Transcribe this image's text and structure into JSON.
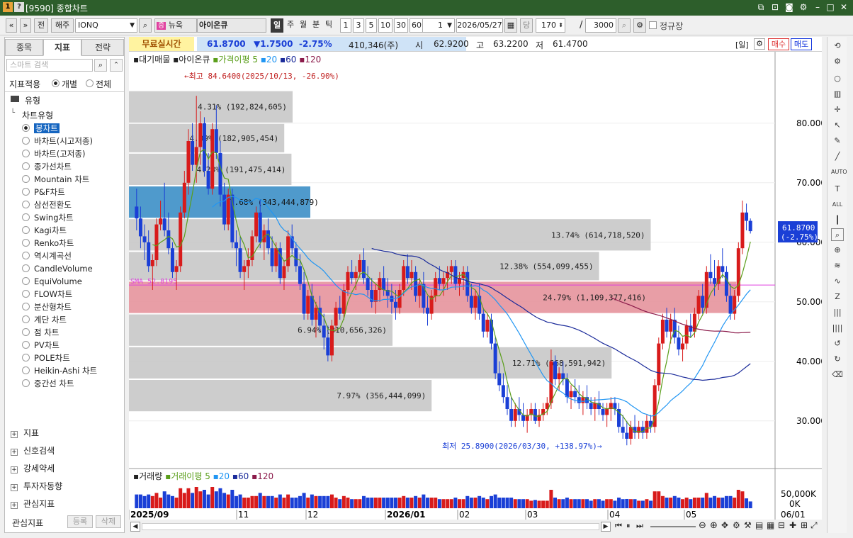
{
  "window": {
    "title": "[9590] 종합차트"
  },
  "toolbar": {
    "nav_prev": "«",
    "nav_next": "»",
    "btn_jeon": "전",
    "market": "해주",
    "symbol": "IONQ",
    "news_label": "뉴옥",
    "stock_name": "아이온큐",
    "periods": [
      "일",
      "주",
      "월",
      "분",
      "틱"
    ],
    "intervals": [
      "1",
      "3",
      "5",
      "10",
      "30",
      "60"
    ],
    "interval_value": "1",
    "date": "2026/05/27",
    "dang": "당",
    "count": "170",
    "total": "3000",
    "regular_session_label": "정규장"
  },
  "left": {
    "tabs": [
      "종목",
      "지표",
      "전략"
    ],
    "search_placeholder": "스마트 검색",
    "apply_label": "지표적용",
    "apply_options": [
      "개별",
      "전체"
    ],
    "section_type": "유형",
    "chart_type_title": "차트유형",
    "chart_types": [
      "봉차트",
      "바차트(시고저종)",
      "바차트(고저종)",
      "종가선차트",
      "Mountain 차트",
      "P&F차트",
      "삼선전환도",
      "Swing차트",
      "Kagi차트",
      "Renko차트",
      "역시계곡선",
      "CandleVolume",
      "EquiVolume",
      "FLOW차트",
      "분산형차트",
      "계단 차트",
      "점 차트",
      "PV차트",
      "POLE차트",
      "Heikin-Ashi 차트",
      "중간선 차트"
    ],
    "groups": [
      "지표",
      "신호검색",
      "강세약세",
      "투자자동향",
      "관심지표"
    ],
    "fav_label": "관심지표",
    "btn_register": "등록",
    "btn_delete": "삭제"
  },
  "info": {
    "realtime": "무료실시간",
    "price": "61.8700",
    "change": "▼1.7500",
    "change_pct": "-2.75%",
    "volume": "410,346(주)",
    "open_label": "시",
    "open": "62.9200",
    "high_label": "고",
    "high": "63.2200",
    "low_label": "저",
    "low": "61.4700",
    "period_label": "[일]",
    "buy": "매수",
    "sell": "매도"
  },
  "legend": {
    "vp": "대기매물",
    "name": "아이온큐",
    "ma_label": "가격이평",
    "ma": [
      "5",
      "20",
      "60",
      "120"
    ]
  },
  "annotations": {
    "high": "←최고 84.6400(2025/10/13, -26.90%)",
    "low": "최저 25.8900(2026/03/30, +138.97%)→",
    "sma": "SMA 52.8195"
  },
  "volume_legend": {
    "label": "거래량",
    "ma_label": "거래이평",
    "ma": [
      "5",
      "20",
      "60",
      "120"
    ]
  },
  "price_scale": [
    "80.0000",
    "70.0000",
    "60.0000",
    "50.0000",
    "40.0000",
    "30.0000"
  ],
  "volume_scale": [
    "50,000K",
    "0K"
  ],
  "current_tag": {
    "price": "61.8700",
    "pct": "(-2.75%)"
  },
  "x_labels": [
    "2025/09",
    "11",
    "12",
    "2026/01",
    "02",
    "03",
    "04",
    "05",
    "06/01"
  ],
  "colors": {
    "up": "#d81b1b",
    "down": "#1a3fd6",
    "ma5": "#5a9e1a",
    "ma20": "#2196f3",
    "ma60": "#1a2a9a",
    "ma120": "#8b1a4a"
  },
  "chart_data": {
    "type": "candlestick",
    "x_start": "2025/09",
    "x_end": "2026/05/27",
    "ylim": [
      22.0,
      92.0
    ],
    "volume_profile": [
      {
        "low": 80.0,
        "high": 85.5,
        "pct": "4.31%",
        "volume": "192,824,605",
        "label": "4.31% (192,824,605)"
      },
      {
        "low": 75.0,
        "high": 80.0,
        "pct": "4.09%",
        "volume": "182,905,454",
        "label": "4.09% (182,905,454)"
      },
      {
        "low": 69.5,
        "high": 75.0,
        "pct": "4.28%",
        "volume": "191,475,414",
        "label": "4.28% (191,475,414)"
      },
      {
        "low": 64.0,
        "high": 69.5,
        "pct": "7.68%",
        "volume": "343,444,879",
        "label": "7.68% (343,444,879)",
        "highlight": "blue"
      },
      {
        "low": 58.5,
        "high": 64.0,
        "pct": "13.74%",
        "volume": "614,718,520",
        "label": "13.74% (614,718,520)"
      },
      {
        "low": 53.5,
        "high": 58.5,
        "pct": "12.38%",
        "volume": "554,099,455",
        "label": "12.38% (554,099,455)"
      },
      {
        "low": 48.0,
        "high": 53.5,
        "pct": "24.79%",
        "volume": "1,109,377,416",
        "label": "24.79% (1,109,377,416)",
        "highlight": "red"
      },
      {
        "low": 42.5,
        "high": 48.0,
        "pct": "6.94%",
        "volume": "310,656,326",
        "label": "6.94% (310,656,326)"
      },
      {
        "low": 37.0,
        "high": 42.5,
        "pct": "12.71%",
        "volume": "568,591,942",
        "label": "12.71% (568,591,942)"
      },
      {
        "low": 31.5,
        "high": 37.0,
        "pct": "7.97%",
        "volume": "356,444,099",
        "label": "7.97% (356,444,099)"
      }
    ],
    "candles": [
      [
        66,
        69,
        62,
        64
      ],
      [
        64,
        66,
        59,
        61
      ],
      [
        61,
        63,
        57,
        60
      ],
      [
        60,
        62,
        55,
        56
      ],
      [
        56,
        58,
        52,
        57
      ],
      [
        57,
        64,
        56,
        63
      ],
      [
        63,
        67,
        62,
        64
      ],
      [
        64,
        70,
        61,
        62
      ],
      [
        62,
        65,
        58,
        59
      ],
      [
        59,
        60,
        54,
        55
      ],
      [
        55,
        57,
        52,
        56
      ],
      [
        56,
        66,
        55,
        65
      ],
      [
        65,
        72,
        64,
        70
      ],
      [
        70,
        79,
        68,
        77
      ],
      [
        77,
        80,
        72,
        73
      ],
      [
        73,
        84.6,
        70,
        76
      ],
      [
        76,
        82,
        73,
        80
      ],
      [
        80,
        81,
        71,
        72
      ],
      [
        72,
        75,
        68,
        69
      ],
      [
        69,
        80,
        68,
        79
      ],
      [
        79,
        83,
        74,
        75
      ],
      [
        75,
        77,
        66,
        68
      ],
      [
        68,
        70,
        62,
        63
      ],
      [
        63,
        69,
        62,
        68
      ],
      [
        68,
        69,
        59,
        60
      ],
      [
        60,
        62,
        56,
        59
      ],
      [
        59,
        61,
        54,
        55
      ],
      [
        55,
        57,
        52,
        56
      ],
      [
        56,
        59,
        54,
        57
      ],
      [
        57,
        62,
        56,
        61
      ],
      [
        61,
        66,
        60,
        65
      ],
      [
        65,
        67,
        59,
        60
      ],
      [
        60,
        63,
        57,
        62
      ],
      [
        62,
        64,
        58,
        59
      ],
      [
        59,
        61,
        55,
        56
      ],
      [
        56,
        60,
        55,
        59
      ],
      [
        59,
        60,
        53,
        54
      ],
      [
        54,
        57,
        52,
        56
      ],
      [
        56,
        62,
        55,
        61
      ],
      [
        61,
        63,
        58,
        59
      ],
      [
        59,
        60,
        55,
        56
      ],
      [
        56,
        58,
        52,
        53
      ],
      [
        53,
        55,
        47,
        48
      ],
      [
        48,
        52,
        47,
        51
      ],
      [
        51,
        53,
        46,
        47
      ],
      [
        47,
        50,
        44,
        49
      ],
      [
        49,
        51,
        45,
        46
      ],
      [
        46,
        48,
        42,
        44
      ],
      [
        44,
        46,
        40,
        41
      ],
      [
        41,
        47,
        40,
        46
      ],
      [
        46,
        50,
        45,
        49
      ],
      [
        49,
        51,
        47,
        48
      ],
      [
        48,
        53,
        47,
        52
      ],
      [
        52,
        56,
        51,
        55
      ],
      [
        55,
        57,
        53,
        54
      ],
      [
        54,
        56,
        52,
        55
      ],
      [
        55,
        58,
        54,
        57
      ],
      [
        57,
        59,
        53,
        54
      ],
      [
        54,
        56,
        51,
        52
      ],
      [
        52,
        54,
        49,
        50
      ],
      [
        50,
        53,
        48,
        52
      ],
      [
        52,
        55,
        50,
        54
      ],
      [
        54,
        56,
        51,
        52
      ],
      [
        52,
        54,
        49,
        51
      ],
      [
        51,
        53,
        48,
        50
      ],
      [
        50,
        52,
        47,
        49
      ],
      [
        49,
        53,
        48,
        52
      ],
      [
        52,
        57,
        51,
        56
      ],
      [
        56,
        58,
        53,
        54
      ],
      [
        54,
        57,
        52,
        55
      ],
      [
        55,
        56,
        50,
        51
      ],
      [
        51,
        54,
        49,
        53
      ],
      [
        53,
        55,
        48,
        49
      ],
      [
        49,
        51,
        46,
        48
      ],
      [
        48,
        52,
        47,
        51
      ],
      [
        51,
        55,
        50,
        54
      ],
      [
        54,
        56,
        52,
        53
      ],
      [
        53,
        55,
        51,
        54
      ],
      [
        54,
        56,
        52,
        55
      ],
      [
        55,
        57,
        53,
        56
      ],
      [
        56,
        57,
        52,
        53
      ],
      [
        53,
        55,
        51,
        54
      ],
      [
        54,
        56,
        52,
        55
      ],
      [
        55,
        56,
        50,
        51
      ],
      [
        51,
        53,
        48,
        49
      ],
      [
        49,
        52,
        47,
        51
      ],
      [
        51,
        53,
        47,
        48
      ],
      [
        48,
        49,
        44,
        45
      ],
      [
        45,
        48,
        44,
        47
      ],
      [
        47,
        48,
        42,
        43
      ],
      [
        43,
        44,
        37,
        38
      ],
      [
        38,
        40,
        35,
        36
      ],
      [
        36,
        38,
        33,
        34
      ],
      [
        34,
        36,
        31,
        32
      ],
      [
        32,
        34,
        29,
        30
      ],
      [
        30,
        33,
        29,
        32
      ],
      [
        32,
        34,
        30,
        31
      ],
      [
        31,
        33,
        29,
        30
      ],
      [
        30,
        32,
        28,
        31
      ],
      [
        31,
        33,
        30,
        32
      ],
      [
        32,
        33,
        29.5,
        30
      ],
      [
        30,
        32,
        29,
        31
      ],
      [
        31,
        33,
        30,
        32
      ],
      [
        32,
        34,
        31,
        33
      ],
      [
        33,
        42,
        32,
        40
      ],
      [
        40,
        41,
        36,
        37
      ],
      [
        37,
        39,
        35,
        38
      ],
      [
        38,
        40,
        36,
        37
      ],
      [
        37,
        38,
        33,
        34
      ],
      [
        34,
        36,
        32,
        35
      ],
      [
        35,
        37,
        33,
        34
      ],
      [
        34,
        36,
        32,
        33
      ],
      [
        33,
        35,
        31,
        34
      ],
      [
        34,
        36,
        32,
        33
      ],
      [
        33,
        34,
        31,
        32
      ],
      [
        32,
        34,
        30,
        33
      ],
      [
        33,
        35,
        31,
        32
      ],
      [
        32,
        33,
        30,
        31
      ],
      [
        31,
        33,
        29,
        32
      ],
      [
        32,
        34,
        30,
        33
      ],
      [
        33,
        34,
        31,
        32
      ],
      [
        32,
        33,
        28,
        29
      ],
      [
        29,
        31,
        27,
        28
      ],
      [
        28,
        30,
        25.9,
        27
      ],
      [
        27,
        30,
        26,
        29
      ],
      [
        29,
        31,
        27,
        28
      ],
      [
        28,
        30,
        27,
        29
      ],
      [
        29,
        30,
        27,
        28
      ],
      [
        28,
        31,
        27,
        30
      ],
      [
        30,
        31,
        28,
        29
      ],
      [
        29,
        37,
        28,
        36
      ],
      [
        36,
        44,
        35,
        43
      ],
      [
        43,
        48,
        42,
        47
      ],
      [
        47,
        49,
        44,
        45
      ],
      [
        45,
        48,
        43,
        47
      ],
      [
        47,
        49,
        43,
        44
      ],
      [
        44,
        46,
        41,
        42
      ],
      [
        42,
        44,
        40,
        43
      ],
      [
        43,
        47,
        42,
        46
      ],
      [
        46,
        48,
        44,
        45
      ],
      [
        45,
        49,
        44,
        48
      ],
      [
        48,
        52,
        47,
        51
      ],
      [
        51,
        53,
        48,
        49
      ],
      [
        49,
        56,
        48,
        55
      ],
      [
        55,
        58,
        53,
        54
      ],
      [
        54,
        57,
        51,
        53
      ],
      [
        53,
        57,
        52,
        56
      ],
      [
        56,
        59,
        54,
        55
      ],
      [
        55,
        56,
        50,
        51
      ],
      [
        51,
        53,
        47,
        48
      ],
      [
        48,
        52,
        47,
        51
      ],
      [
        51,
        60,
        50,
        59
      ],
      [
        59,
        67,
        58,
        65
      ],
      [
        65,
        66.5,
        62,
        63.6
      ],
      [
        63.6,
        64,
        61.47,
        61.87
      ]
    ],
    "volume_series": "per-candle volume bars, scale 0K–50,000K"
  }
}
